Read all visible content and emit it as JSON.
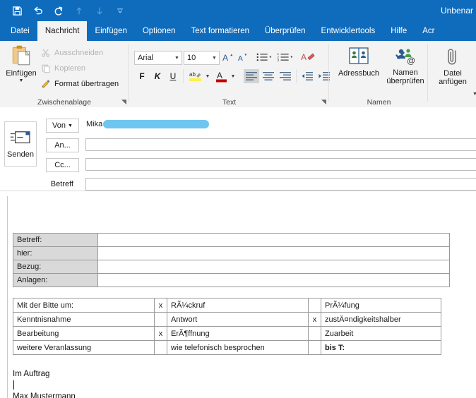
{
  "titlebar": {
    "document_title": "Unbenar",
    "quick_access": [
      {
        "name": "save-icon",
        "label": "Speichern",
        "enabled": true
      },
      {
        "name": "undo-icon",
        "label": "Rückgängig",
        "enabled": true
      },
      {
        "name": "redo-icon",
        "label": "Wiederholen",
        "enabled": true
      },
      {
        "name": "previous-item-icon",
        "label": "Vorheriges Element",
        "enabled": false
      },
      {
        "name": "next-item-icon",
        "label": "Nächstes Element",
        "enabled": false
      },
      {
        "name": "customize-qat-icon",
        "label": "Symbolleiste anpassen",
        "enabled": true
      }
    ]
  },
  "tabs": [
    {
      "label": "Datei",
      "active": false
    },
    {
      "label": "Nachricht",
      "active": true
    },
    {
      "label": "Einfügen",
      "active": false
    },
    {
      "label": "Optionen",
      "active": false
    },
    {
      "label": "Text formatieren",
      "active": false
    },
    {
      "label": "Überprüfen",
      "active": false
    },
    {
      "label": "Entwicklertools",
      "active": false
    },
    {
      "label": "Hilfe",
      "active": false
    },
    {
      "label": "Acr",
      "active": false
    }
  ],
  "ribbon": {
    "clipboard": {
      "group_label": "Zwischenablage",
      "paste_label": "Einfügen",
      "cut_label": "Ausschneiden",
      "copy_label": "Kopieren",
      "format_painter_label": "Format übertragen"
    },
    "text": {
      "group_label": "Text",
      "font_family": "Arial",
      "font_size": "10",
      "bold_label": "F",
      "italic_label": "K",
      "underline_label": "U",
      "font_color_label": "A"
    },
    "names": {
      "group_label": "Namen",
      "address_book_label": "Adressbuch",
      "check_names_label_line1": "Namen",
      "check_names_label_line2": "überprüfen"
    },
    "include": {
      "attach_file_label_line1": "Datei",
      "attach_file_label_line2": "anfügen"
    }
  },
  "compose": {
    "send_label": "Senden",
    "from_label": "Von",
    "to_label": "An...",
    "cc_label": "Cc...",
    "subject_label": "Betreff",
    "from_value": "Mika",
    "to_value": "",
    "cc_value": "",
    "subject_value": ""
  },
  "body": {
    "fields_table": [
      {
        "label": "Betreff:",
        "value": ""
      },
      {
        "label": "hier:",
        "value": ""
      },
      {
        "label": "Bezug:",
        "value": ""
      },
      {
        "label": "Anlagen:",
        "value": ""
      }
    ],
    "tasks_table": {
      "rows": [
        {
          "left": "Mit der Bitte um:",
          "left_indent": false,
          "mark1": "x",
          "middle": "RÃ¼ckruf",
          "mark2": "",
          "right": "PrÃ¼fung",
          "right_bold": false
        },
        {
          "left": "Kenntnisnahme",
          "left_indent": true,
          "mark1": "",
          "middle": "Antwort",
          "mark2": "x",
          "right": "zustÄ¤ndigkeitshalber",
          "right_bold": false
        },
        {
          "left": "Bearbeitung",
          "left_indent": true,
          "mark1": "x",
          "middle": "ErÃ¶ffnung",
          "mark2": "",
          "right": "Zuarbeit",
          "right_bold": false
        },
        {
          "left": "weitere Veranlassung",
          "left_indent": true,
          "mark1": "",
          "middle": "wie telefonisch besprochen",
          "mark2": "",
          "right": "bis T:",
          "right_bold": true
        }
      ]
    },
    "signature": {
      "line1": "Im Auftrag",
      "line2": "Max Mustermann"
    }
  },
  "colors": {
    "accent": "#0f6cbd",
    "ribbon_bg": "#f3f3f3",
    "redaction": "#6ec6f0",
    "table_header_bg": "#d9d9d9"
  }
}
